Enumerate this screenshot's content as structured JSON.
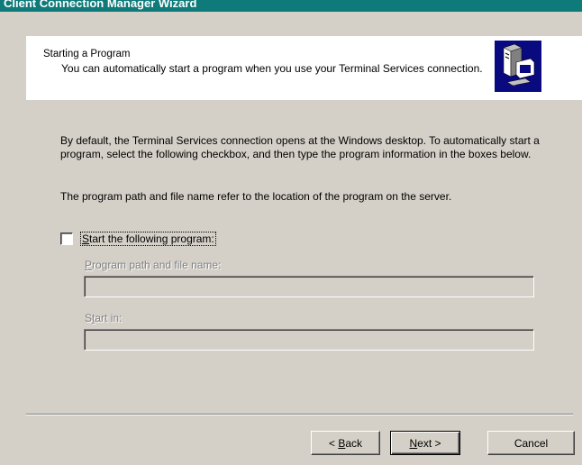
{
  "window": {
    "title": "Client Connection Manager Wizard"
  },
  "header": {
    "title": "Starting a Program",
    "description": "You can automatically start a program when you use your Terminal Services connection."
  },
  "body": {
    "paragraph1": "By default, the Terminal Services connection opens at the Windows desktop. To automatically start a program, select the following checkbox, and then type the program information in the boxes below.",
    "paragraph2": "The program path and file name refer to the location of the program on the server."
  },
  "start_program": {
    "checked": false,
    "label_mnemonic": "S",
    "label_rest": "tart the following program:"
  },
  "program_path": {
    "label_mnemonic": "P",
    "label_rest": "rogram path and file name:",
    "value": ""
  },
  "start_in": {
    "label_before": "S",
    "label_mnemonic": "t",
    "label_rest": "art in:",
    "value": ""
  },
  "buttons": {
    "back": {
      "prefix": "< ",
      "mnemonic": "B",
      "rest": "ack"
    },
    "next": {
      "mnemonic": "N",
      "rest": "ext >"
    },
    "cancel": {
      "label": "Cancel"
    }
  }
}
